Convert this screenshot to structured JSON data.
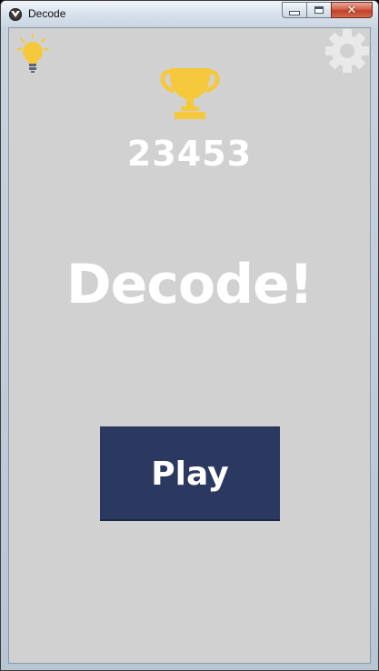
{
  "window": {
    "title": "Decode",
    "controls": {
      "minimize": "minimize",
      "maximize": "maximize",
      "close": "✕"
    }
  },
  "header": {
    "hint_icon": "lightbulb-icon",
    "settings_icon": "gear-icon",
    "trophy_icon": "trophy-icon"
  },
  "main": {
    "high_score": "23453",
    "title": "Decode!",
    "play_label": "Play"
  },
  "colors": {
    "background": "#d1d1d1",
    "accent_yellow": "#f6c93c",
    "button_navy": "#2b3961",
    "gear_gray": "#e9e9e9",
    "text_white": "#ffffff"
  }
}
